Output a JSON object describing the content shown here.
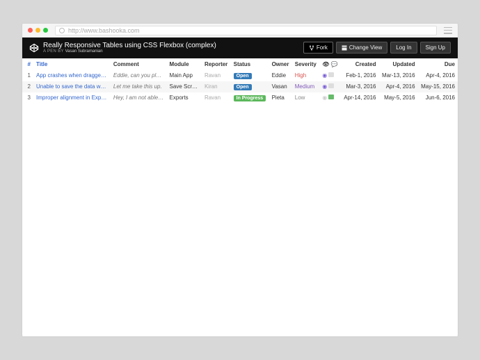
{
  "browser": {
    "url": "http://www.bashooka.com"
  },
  "header": {
    "title": "Really Responsive Tables using CSS Flexbox (complex)",
    "author_prefix": "A PEN BY ",
    "author": "Vasan Subramanian",
    "buttons": {
      "fork": "Fork",
      "change_view": "Change View",
      "log_in": "Log In",
      "sign_up": "Sign Up"
    }
  },
  "table": {
    "headers": {
      "num": "#",
      "title": "Title",
      "comment": "Comment",
      "module": "Module",
      "reporter": "Reporter",
      "status": "Status",
      "owner": "Owner",
      "severity": "Severity",
      "created": "Created",
      "updated": "Updated",
      "due": "Due"
    },
    "rows": [
      {
        "num": "1",
        "title": "App crashes when dragged by ti…",
        "comment": "Eddie, can you plea…",
        "module": "Main App",
        "reporter": "Ravan",
        "status": "Open",
        "status_class": "open",
        "owner": "Eddie",
        "severity": "High",
        "sev_class": "sev-high",
        "eye": "on",
        "chat": "dim",
        "created": "Feb-1, 2016",
        "updated": "Mar-13, 2016",
        "due": "Apr-4, 2016"
      },
      {
        "num": "2",
        "title": "Unable to save the data when us…",
        "comment": "Let me take this up.",
        "module": "Save Screen",
        "reporter": "Kiran",
        "status": "Open",
        "status_class": "open",
        "owner": "Vasan",
        "severity": "Medium",
        "sev_class": "sev-medium",
        "eye": "on",
        "chat": "dim",
        "created": "Mar-3, 2016",
        "updated": "Apr-4, 2016",
        "due": "May-15, 2016"
      },
      {
        "num": "3",
        "title": "Improper alignment in Export sec…",
        "comment": "Hey, I am not able t…",
        "module": "Exports",
        "reporter": "Ravan",
        "status": "In Progress",
        "status_class": "progress",
        "owner": "Pieta",
        "severity": "Low",
        "sev_class": "sev-low",
        "eye": "dim",
        "chat": "on",
        "created": "Apr-14, 2016",
        "updated": "May-5, 2016",
        "due": "Jun-6, 2016"
      }
    ]
  }
}
